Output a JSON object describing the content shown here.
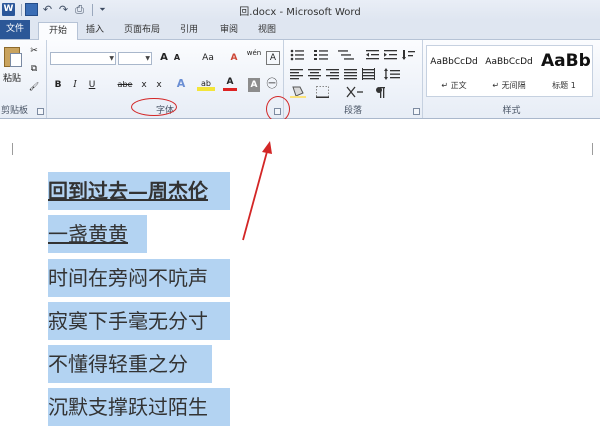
{
  "window": {
    "title": "回.docx - Microsoft Word",
    "app_icon": "W"
  },
  "quick_access": {
    "icons": [
      "word-icon",
      "save-icon",
      "undo-icon",
      "redo-icon",
      "print-icon"
    ],
    "undo_glyph": "↶",
    "redo_glyph": "↷",
    "print_glyph": "⎙",
    "more_glyph": "⏷"
  },
  "tabs": [
    {
      "label": "文件",
      "active": false,
      "file": true
    },
    {
      "label": "开始",
      "active": true
    },
    {
      "label": "插入",
      "active": false
    },
    {
      "label": "页面布局",
      "active": false
    },
    {
      "label": "引用",
      "active": false
    },
    {
      "label": "审阅",
      "active": false
    },
    {
      "label": "视图",
      "active": false
    }
  ],
  "ribbon": {
    "clipboard": {
      "label": "剪贴板",
      "paste_label": "粘贴",
      "cut_glyph": "✂",
      "copy_glyph": "⧉",
      "format_painter_glyph": "🖌"
    },
    "font": {
      "label": "字体",
      "grow_font": "A",
      "shrink_font": "A",
      "change_case": "Aa",
      "clear_format": "A",
      "phonetic": "wén",
      "enclose": "A",
      "bold": "B",
      "italic": "I",
      "underline": "U",
      "strikethrough": "abe",
      "subscript": "x",
      "superscript": "x",
      "text_effects": "A",
      "highlight": "ab",
      "font_color": "A",
      "char_shading": "A",
      "enclose_char": "㊀",
      "launcher": "⌟"
    },
    "paragraph": {
      "label": "段落",
      "launcher": "⌟"
    },
    "styles": {
      "label": "样式",
      "items": [
        {
          "sample": "AaBbCcDd",
          "name": "↵ 正文"
        },
        {
          "sample": "AaBbCcDd",
          "name": "↵ 无间隔"
        },
        {
          "sample": "AaBb",
          "name": "标题 1"
        }
      ]
    }
  },
  "document": {
    "lines": [
      {
        "text": "回到过去—周杰伦",
        "style": "title"
      },
      {
        "text": "一盏黄黄",
        "style": "underline"
      },
      {
        "text": "时间在旁闷不吭声",
        "style": "normal"
      },
      {
        "text": "寂寞下手毫无分寸",
        "style": "normal"
      },
      {
        "text": "不懂得轻重之分",
        "style": "normal"
      },
      {
        "text": "沉默支撑跃过陌生",
        "style": "normal"
      }
    ]
  },
  "colors": {
    "file_tab": "#2b5797",
    "selection": "#b3d3f2",
    "annotation": "#d32626"
  }
}
